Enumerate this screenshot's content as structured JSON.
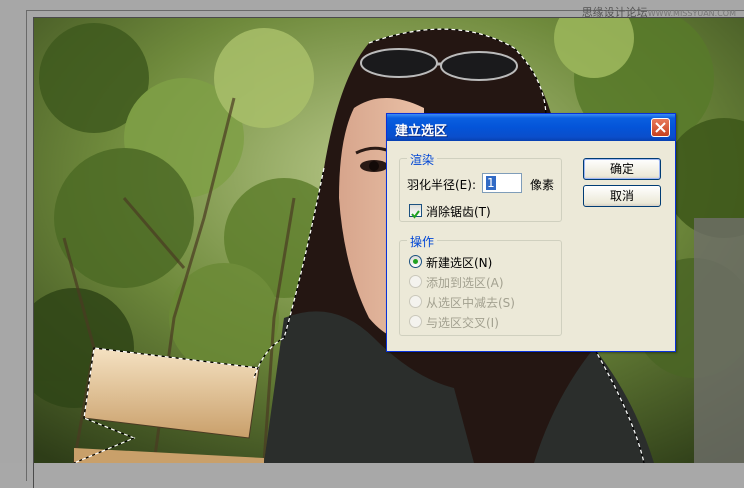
{
  "watermark": {
    "brand": "思缘设计论坛",
    "url": "WWW.MISSYUAN.COM"
  },
  "dialog": {
    "title": "建立选区",
    "render_group": {
      "legend": "渲染",
      "feather_label": "羽化半径(E):",
      "feather_value": "1",
      "feather_unit": "像素",
      "antialias_label": "消除锯齿(T)",
      "antialias_checked": true
    },
    "operation_group": {
      "legend": "操作",
      "options": [
        {
          "label": "新建选区(N)",
          "selected": true,
          "enabled": true
        },
        {
          "label": "添加到选区(A)",
          "selected": false,
          "enabled": false
        },
        {
          "label": "从选区中减去(S)",
          "selected": false,
          "enabled": false
        },
        {
          "label": "与选区交叉(I)",
          "selected": false,
          "enabled": false
        }
      ]
    },
    "buttons": {
      "ok": "确定",
      "cancel": "取消"
    }
  },
  "colors": {
    "titlebar": "#0454d8",
    "dialog_bg": "#ece9d8",
    "legend_text": "#0046d5",
    "close_button": "#c7401f"
  }
}
